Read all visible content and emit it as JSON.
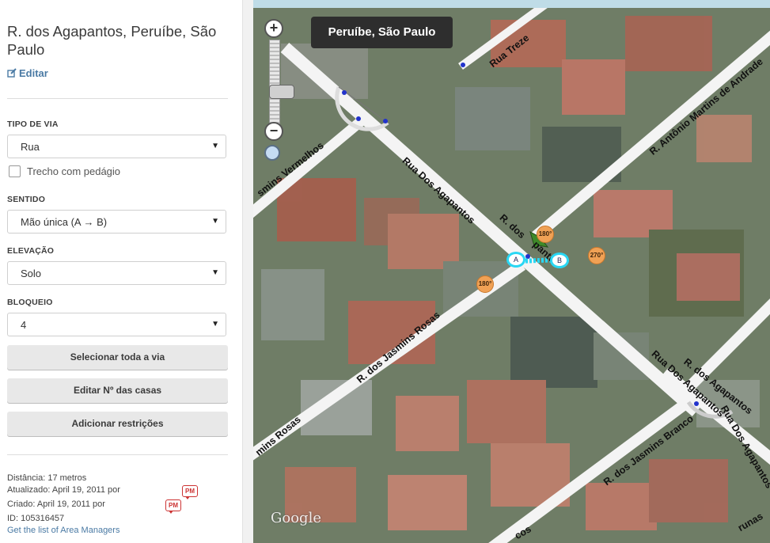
{
  "segment": {
    "title": "R. dos Agapantos, Peruíbe, São Paulo",
    "edit_label": "Editar"
  },
  "fields": {
    "road_type": {
      "label": "TIPO DE VIA",
      "value": "Rua"
    },
    "toll": {
      "label": "Trecho com pedágio",
      "checked": false
    },
    "direction": {
      "label": "SENTIDO",
      "value": "Mão única (A → B)"
    },
    "elevation": {
      "label": "ELEVAÇÃO",
      "value": "Solo"
    },
    "lock": {
      "label": "BLOQUEIO",
      "value": "4"
    }
  },
  "buttons": {
    "select_all": "Selecionar toda a via",
    "edit_house_numbers": "Editar Nº das casas",
    "add_restrictions": "Adicionar restrições"
  },
  "meta": {
    "distance": "Distância: 17 metros",
    "updated": "Atualizado: April 19, 2011 por",
    "created": "Criado: April 19, 2011 por",
    "id": "ID: 105316457",
    "link": "Get the list of Area Managers",
    "pm_badge": "PM"
  },
  "map": {
    "location_badge": "Peruíbe, São Paulo",
    "watermark": "Google",
    "zoom_in": "+",
    "zoom_out": "−",
    "streets": {
      "rua_treze": "Rua Treze",
      "antonio": "R. Antônio Martins de Andrade",
      "vermelhos": "smins Vermelhos",
      "agapantos_upper": "Rua Dos Agapantos",
      "dos_agapantos_short": "R. dos",
      "agapantos_suffix": "pantos",
      "jasmins_rosas": "R. dos Jasmins Rosas",
      "rosas_left": "mins Rosas",
      "agapantos_lower": "Rua Dos Agapantos",
      "r_dos_agapantos_lower": "R. dos Agapantos",
      "agapantos_ghost": "Rua Dos Agapantos",
      "jasmins_branco": "R. dos Jasmins Branco",
      "bottom_cos": "cos",
      "bottom_runas": "runas"
    },
    "chips": {
      "c180a": "180°",
      "c180b": "180°",
      "c270": "270°"
    },
    "nodes": {
      "a": "A",
      "b": "B"
    },
    "colors": {
      "road": "#f4f4f4",
      "selected": "#29d7f4",
      "chip": "#f0a155",
      "arrow": "#3f8a2a"
    }
  }
}
